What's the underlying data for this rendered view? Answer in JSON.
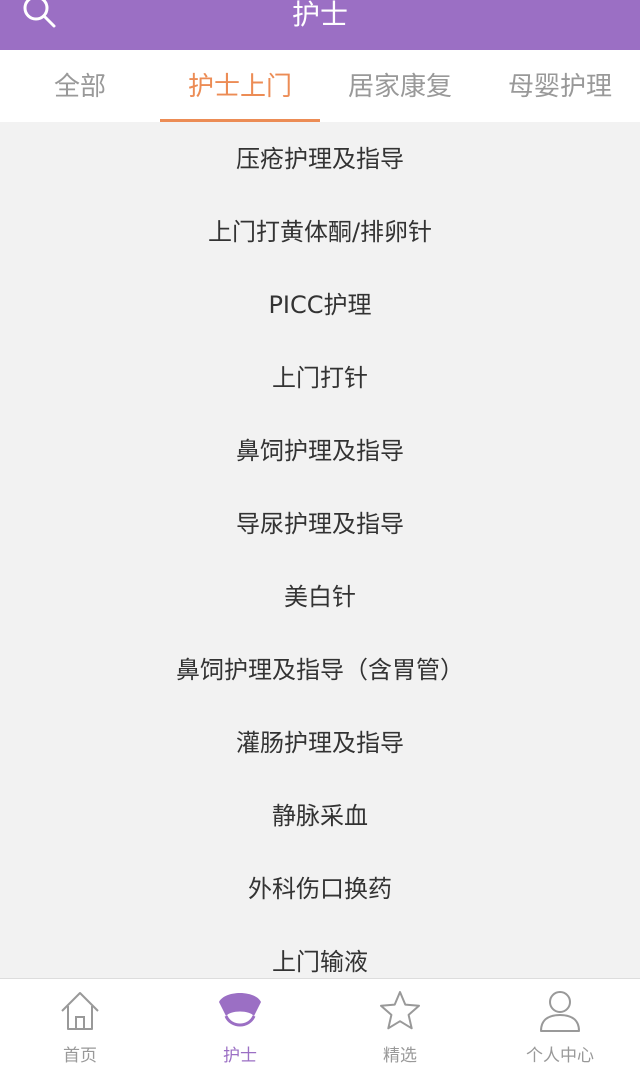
{
  "header": {
    "title": "护士",
    "search_icon": "search-icon"
  },
  "tabs": [
    {
      "label": "全部",
      "active": false
    },
    {
      "label": "护士上门",
      "active": true
    },
    {
      "label": "居家康复",
      "active": false
    },
    {
      "label": "母婴护理",
      "active": false
    }
  ],
  "services": [
    "压疮护理及指导",
    "上门打黄体酮/排卵针",
    "PICC护理",
    "上门打针",
    "鼻饲护理及指导",
    "导尿护理及指导",
    "美白针",
    "鼻饲护理及指导（含胃管）",
    "灌肠护理及指导",
    "静脉采血",
    "外科伤口换药",
    "上门输液"
  ],
  "tabbar": [
    {
      "label": "首页",
      "icon": "home-icon",
      "active": false
    },
    {
      "label": "护士",
      "icon": "nurse-cap-icon",
      "active": true
    },
    {
      "label": "精选",
      "icon": "star-icon",
      "active": false
    },
    {
      "label": "个人中心",
      "icon": "user-icon",
      "active": false
    }
  ],
  "colors": {
    "brand_purple": "#9b6fc4",
    "active_orange": "#ec8c55",
    "text_gray": "#999999",
    "text_dark": "#333333",
    "background": "#f2f2f2"
  }
}
